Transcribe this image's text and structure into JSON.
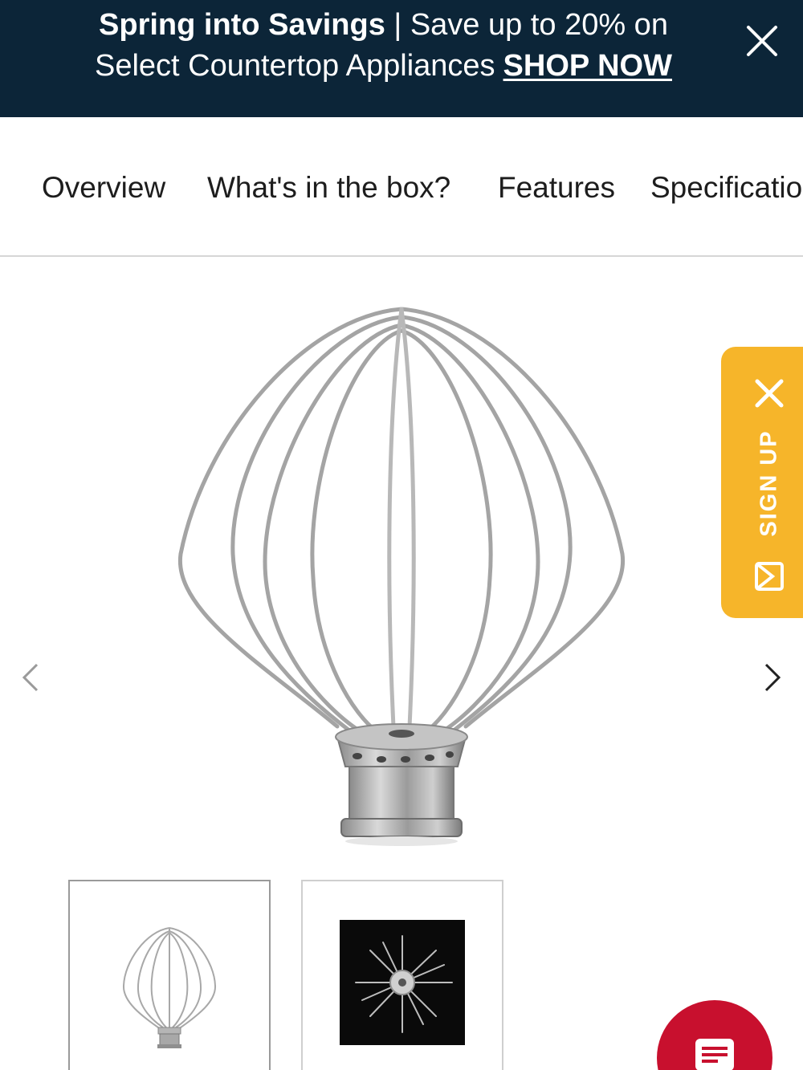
{
  "promo": {
    "headline": "Spring into Savings",
    "separator": " | ",
    "offer_line": "Save up to 20% on",
    "subline": "Select Countertop Appliances",
    "link_label": "SHOP NOW",
    "close_icon": "close-icon"
  },
  "tabs": [
    {
      "label": "Overview"
    },
    {
      "label": "What's in the box?"
    },
    {
      "label": "Features"
    },
    {
      "label": "Specifications"
    }
  ],
  "gallery": {
    "prev_icon": "chevron-left-icon",
    "next_icon": "chevron-right-icon",
    "main_image": "wire-whip-attachment"
  },
  "signup": {
    "label": "SIGN UP",
    "close_icon": "close-icon",
    "mail_icon": "mail-icon",
    "color": "#f6b52a"
  },
  "thumbnails": [
    {
      "image": "wire-whip-thumbnail",
      "selected": true
    },
    {
      "image": "wire-whip-top-view-thumbnail",
      "selected": false
    }
  ],
  "chat": {
    "icon": "chat-icon",
    "color": "#c8102e"
  },
  "colors": {
    "banner": "#0c2538",
    "accent": "#f6b52a",
    "chat": "#c8102e"
  }
}
